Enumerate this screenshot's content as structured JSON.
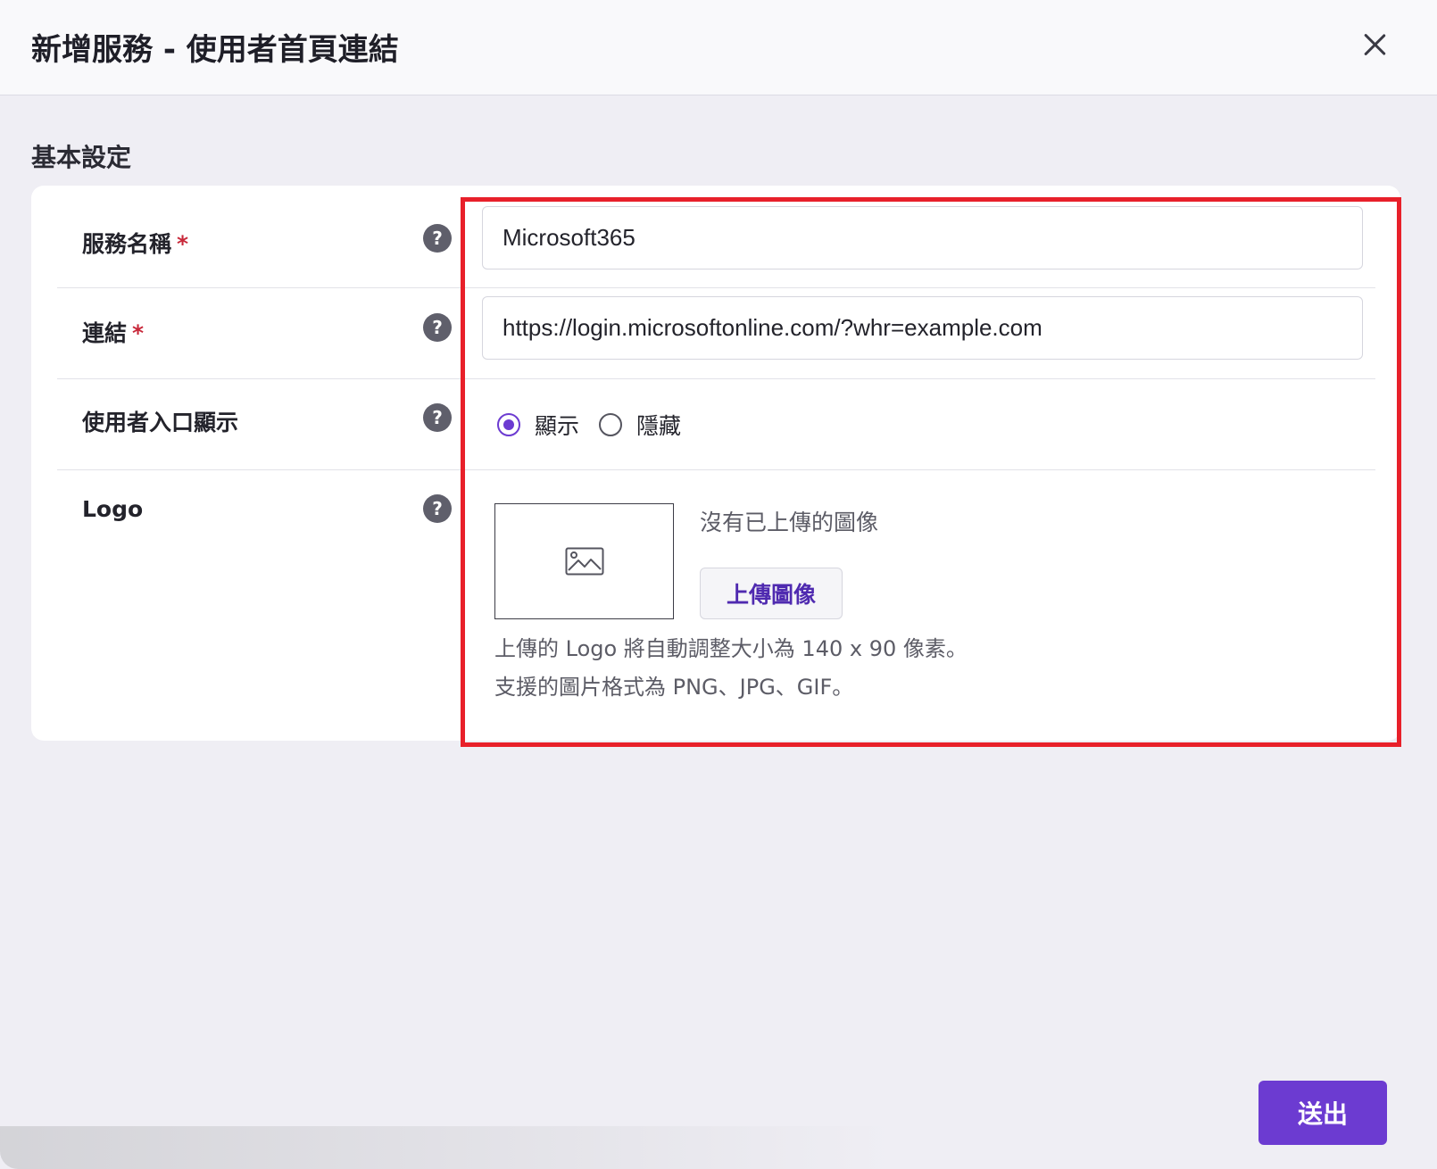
{
  "header": {
    "title": "新增服務 - 使用者首頁連結",
    "close_icon": "close-icon"
  },
  "section": {
    "title": "基本設定"
  },
  "form": {
    "service_name": {
      "label": "服務名稱",
      "required_mark": "*",
      "value": "Microsoft365",
      "help": "?"
    },
    "link": {
      "label": "連結",
      "required_mark": "*",
      "value": "https://login.microsoftonline.com/?whr=example.com",
      "help": "?"
    },
    "portal_display": {
      "label": "使用者入口顯示",
      "help": "?",
      "options": [
        {
          "label": "顯示",
          "checked": true
        },
        {
          "label": "隱藏",
          "checked": false
        }
      ]
    },
    "logo": {
      "label": "Logo",
      "help": "?",
      "placeholder_icon": "image-placeholder-icon",
      "status": "沒有已上傳的圖像",
      "upload_label": "上傳圖像",
      "hint_1": "上傳的 Logo 將自動調整大小為 140 x 90 像素。",
      "hint_2": "支援的圖片格式為 PNG、JPG、GIF。"
    }
  },
  "footer": {
    "submit_label": "送出"
  },
  "colors": {
    "accent": "#6c3bd1",
    "highlight": "#e8202a",
    "required": "#c8283a"
  }
}
